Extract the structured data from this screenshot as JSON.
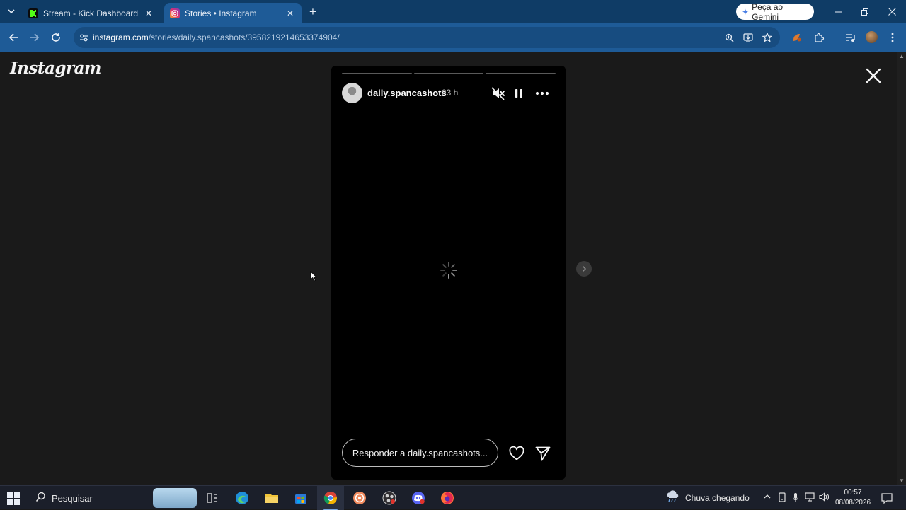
{
  "browser": {
    "tabs": [
      {
        "title": "Stream - Kick Dashboard",
        "favicon_color": "#53fc18",
        "active": false
      },
      {
        "title": "Stories • Instagram",
        "favicon_color": "#e1306c",
        "active": true
      }
    ],
    "gemini_label": "Peça ao Gemini",
    "url_host": "instagram.com",
    "url_path": "/stories/daily.spancashots/3958219214653374904/"
  },
  "page": {
    "logo_text": "Instagram",
    "story": {
      "username": "daily.spancashots",
      "time_ago": "23 h",
      "progress_segments": 3,
      "reply_placeholder": "Responder a daily.spancashots..."
    }
  },
  "taskbar": {
    "search_label": "Pesquisar",
    "weather_text": "Chuva chegando",
    "clock_time": "00:57",
    "clock_date": "08/08/2026"
  },
  "colors": {
    "tabstrip": "#0f3c66",
    "toolbar": "#1e5b97",
    "page_bg": "#1a1a1a",
    "story_bg": "#000000"
  }
}
